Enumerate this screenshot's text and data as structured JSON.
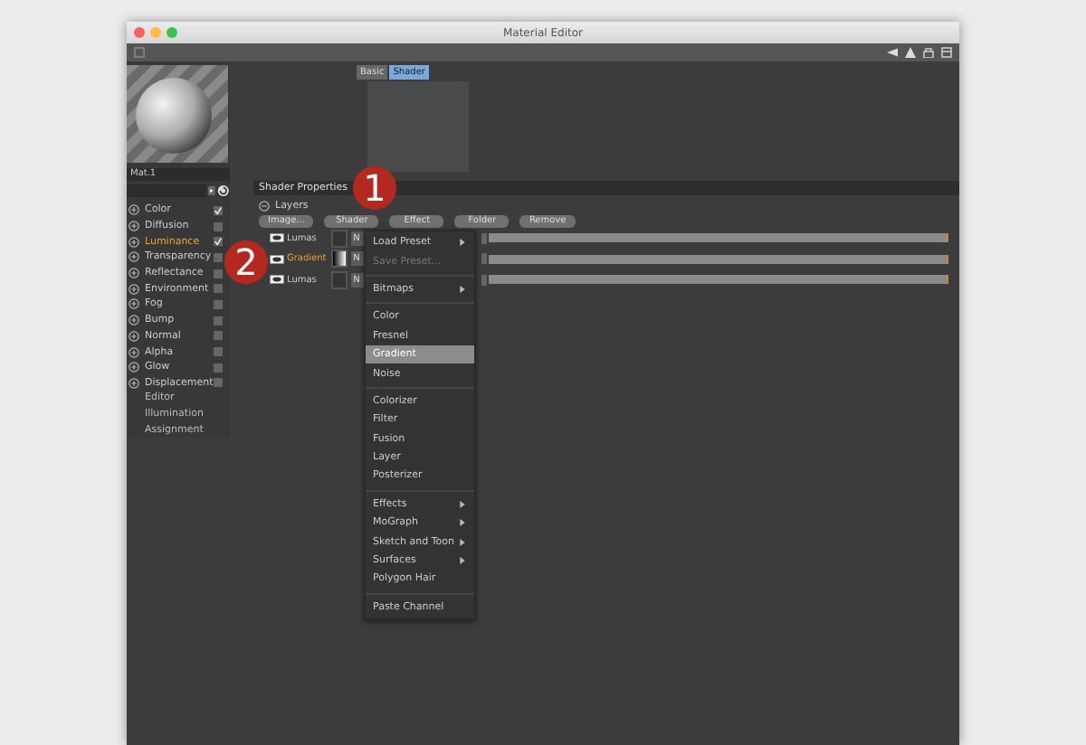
{
  "window": {
    "title": "Material Editor"
  },
  "material": {
    "name": "Mat.1"
  },
  "channels": [
    {
      "label": "Color",
      "selected": false,
      "checked": true
    },
    {
      "label": "Diffusion",
      "selected": false,
      "checked": false
    },
    {
      "label": "Luminance",
      "selected": true,
      "checked": true
    },
    {
      "label": "Transparency",
      "selected": false,
      "checked": false
    },
    {
      "label": "Reflectance",
      "selected": false,
      "checked": false
    },
    {
      "label": "Environment",
      "selected": false,
      "checked": false
    },
    {
      "label": "Fog",
      "selected": false,
      "checked": false
    },
    {
      "label": "Bump",
      "selected": false,
      "checked": false
    },
    {
      "label": "Normal",
      "selected": false,
      "checked": false
    },
    {
      "label": "Alpha",
      "selected": false,
      "checked": false
    },
    {
      "label": "Glow",
      "selected": false,
      "checked": false
    },
    {
      "label": "Displacement",
      "selected": false,
      "checked": false
    }
  ],
  "pages": [
    "Editor",
    "Illumination",
    "Assignment"
  ],
  "tabs": [
    {
      "label": "Basic",
      "selected": false
    },
    {
      "label": "Shader",
      "selected": true
    }
  ],
  "section": {
    "title": "Shader Properties",
    "group": "Layers"
  },
  "buttons": [
    "Image...",
    "Shader",
    "Effect",
    "Folder",
    "Remove"
  ],
  "layers": [
    {
      "name": "Lumas",
      "selected": false,
      "swatch": false,
      "mode": "N",
      "level": 1
    },
    {
      "name": "Gradient",
      "selected": true,
      "swatch": true,
      "mode": "N",
      "level": 1
    },
    {
      "name": "Lumas",
      "selected": false,
      "swatch": false,
      "mode": "N",
      "level": 1
    }
  ],
  "menu": [
    [
      {
        "label": "Load Preset",
        "submenu": true,
        "disabled": false,
        "selected": false
      },
      {
        "label": "Save Preset...",
        "submenu": false,
        "disabled": true,
        "selected": false
      }
    ],
    [
      {
        "label": "Bitmaps",
        "submenu": true,
        "disabled": false,
        "selected": false
      }
    ],
    [
      {
        "label": "Color",
        "submenu": false,
        "disabled": false,
        "selected": false
      },
      {
        "label": "Fresnel",
        "submenu": false,
        "disabled": false,
        "selected": false
      },
      {
        "label": "Gradient",
        "submenu": false,
        "disabled": false,
        "selected": true
      },
      {
        "label": "Noise",
        "submenu": false,
        "disabled": false,
        "selected": false
      }
    ],
    [
      {
        "label": "Colorizer",
        "submenu": false,
        "disabled": false,
        "selected": false
      },
      {
        "label": "Filter",
        "submenu": false,
        "disabled": false,
        "selected": false
      },
      {
        "label": "Fusion",
        "submenu": false,
        "disabled": false,
        "selected": false
      },
      {
        "label": "Layer",
        "submenu": false,
        "disabled": false,
        "selected": false
      },
      {
        "label": "Posterizer",
        "submenu": false,
        "disabled": false,
        "selected": false
      }
    ],
    [
      {
        "label": "Effects",
        "submenu": true,
        "disabled": false,
        "selected": false
      },
      {
        "label": "MoGraph",
        "submenu": true,
        "disabled": false,
        "selected": false
      },
      {
        "label": "Sketch and Toon",
        "submenu": true,
        "disabled": false,
        "selected": false
      },
      {
        "label": "Surfaces",
        "submenu": true,
        "disabled": false,
        "selected": false
      },
      {
        "label": "Polygon Hair",
        "submenu": false,
        "disabled": false,
        "selected": false
      }
    ],
    [
      {
        "label": "Paste Channel",
        "submenu": false,
        "disabled": false,
        "selected": false
      }
    ]
  ],
  "callouts": [
    "1",
    "2"
  ]
}
